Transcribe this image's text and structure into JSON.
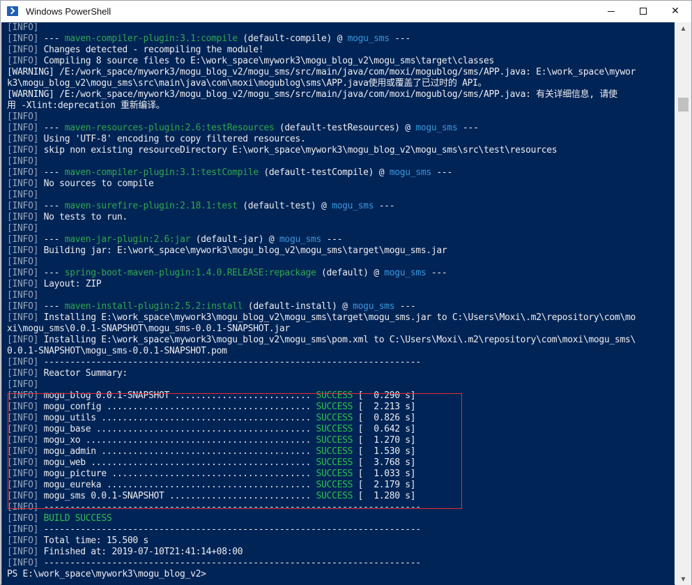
{
  "window": {
    "title": "Windows PowerShell",
    "buttons": {
      "minimize": "—",
      "maximize": "☐",
      "close": "✕"
    }
  },
  "colors": {
    "terminal_bg": "#012456",
    "success": "#2fbf4f",
    "plugin": "#2fa84f",
    "project": "#3a96dd",
    "highlight_border": "#e03030"
  },
  "icons": {
    "app": "powershell-icon"
  },
  "terminal": {
    "lines": [
      [
        {
          "t": "[INFO]",
          "c": "info"
        }
      ],
      [
        {
          "t": "[INFO]",
          "c": "info"
        },
        {
          "t": " --- ",
          "c": "text"
        },
        {
          "t": "maven-compiler-plugin:3.1:compile",
          "c": "plugin"
        },
        {
          "t": " (default-compile) @ ",
          "c": "text"
        },
        {
          "t": "mogu_sms",
          "c": "project"
        },
        {
          "t": " ---",
          "c": "text"
        }
      ],
      [
        {
          "t": "[INFO]",
          "c": "info"
        },
        {
          "t": " Changes detected - recompiling the module!",
          "c": "text"
        }
      ],
      [
        {
          "t": "[INFO]",
          "c": "info"
        },
        {
          "t": " Compiling 8 source files to E:\\work_space\\mywork3\\mogu_blog_v2\\mogu_sms\\target\\classes",
          "c": "text"
        }
      ],
      [
        {
          "t": "[WARNING] /E:/work_space/mywork3/mogu_blog_v2/mogu_sms/src/main/java/com/moxi/mogublog/sms/APP.java: E:\\work_space\\mywor",
          "c": "warn"
        }
      ],
      [
        {
          "t": "k3\\mogu_blog_v2\\mogu_sms\\src\\main\\java\\com\\moxi\\mogublog\\sms\\APP.java使用或覆盖了已过时的 API。",
          "c": "warn"
        }
      ],
      [
        {
          "t": "[WARNING] /E:/work_space/mywork3/mogu_blog_v2/mogu_sms/src/main/java/com/moxi/mogublog/sms/APP.java: 有关详细信息, 请使",
          "c": "warn"
        }
      ],
      [
        {
          "t": "用 -Xlint:deprecation 重新编译。",
          "c": "warn"
        }
      ],
      [
        {
          "t": "[INFO]",
          "c": "info"
        }
      ],
      [
        {
          "t": "[INFO]",
          "c": "info"
        },
        {
          "t": " --- ",
          "c": "text"
        },
        {
          "t": "maven-resources-plugin:2.6:testResources",
          "c": "plugin"
        },
        {
          "t": " (default-testResources) @ ",
          "c": "text"
        },
        {
          "t": "mogu_sms",
          "c": "project"
        },
        {
          "t": " ---",
          "c": "text"
        }
      ],
      [
        {
          "t": "[INFO]",
          "c": "info"
        },
        {
          "t": " Using 'UTF-8' encoding to copy filtered resources.",
          "c": "text"
        }
      ],
      [
        {
          "t": "[INFO]",
          "c": "info"
        },
        {
          "t": " skip non existing resourceDirectory E:\\work_space\\mywork3\\mogu_blog_v2\\mogu_sms\\src\\test\\resources",
          "c": "text"
        }
      ],
      [
        {
          "t": "[INFO]",
          "c": "info"
        }
      ],
      [
        {
          "t": "[INFO]",
          "c": "info"
        },
        {
          "t": " --- ",
          "c": "text"
        },
        {
          "t": "maven-compiler-plugin:3.1:testCompile",
          "c": "plugin"
        },
        {
          "t": " (default-testCompile) @ ",
          "c": "text"
        },
        {
          "t": "mogu_sms",
          "c": "project"
        },
        {
          "t": " ---",
          "c": "text"
        }
      ],
      [
        {
          "t": "[INFO]",
          "c": "info"
        },
        {
          "t": " No sources to compile",
          "c": "text"
        }
      ],
      [
        {
          "t": "[INFO]",
          "c": "info"
        }
      ],
      [
        {
          "t": "[INFO]",
          "c": "info"
        },
        {
          "t": " --- ",
          "c": "text"
        },
        {
          "t": "maven-surefire-plugin:2.18.1:test",
          "c": "plugin"
        },
        {
          "t": " (default-test) @ ",
          "c": "text"
        },
        {
          "t": "mogu_sms",
          "c": "project"
        },
        {
          "t": " ---",
          "c": "text"
        }
      ],
      [
        {
          "t": "[INFO]",
          "c": "info"
        },
        {
          "t": " No tests to run.",
          "c": "text"
        }
      ],
      [
        {
          "t": "[INFO]",
          "c": "info"
        }
      ],
      [
        {
          "t": "[INFO]",
          "c": "info"
        },
        {
          "t": " --- ",
          "c": "text"
        },
        {
          "t": "maven-jar-plugin:2.6:jar",
          "c": "plugin"
        },
        {
          "t": " (default-jar) @ ",
          "c": "text"
        },
        {
          "t": "mogu_sms",
          "c": "project"
        },
        {
          "t": " ---",
          "c": "text"
        }
      ],
      [
        {
          "t": "[INFO]",
          "c": "info"
        },
        {
          "t": " Building jar: E:\\work_space\\mywork3\\mogu_blog_v2\\mogu_sms\\target\\mogu_sms.jar",
          "c": "text"
        }
      ],
      [
        {
          "t": "[INFO]",
          "c": "info"
        }
      ],
      [
        {
          "t": "[INFO]",
          "c": "info"
        },
        {
          "t": " --- ",
          "c": "text"
        },
        {
          "t": "spring-boot-maven-plugin:1.4.0.RELEASE:repackage",
          "c": "plugin"
        },
        {
          "t": " (default) @ ",
          "c": "text"
        },
        {
          "t": "mogu_sms",
          "c": "project"
        },
        {
          "t": " ---",
          "c": "text"
        }
      ],
      [
        {
          "t": "[INFO]",
          "c": "info"
        },
        {
          "t": " Layout: ZIP",
          "c": "text"
        }
      ],
      [
        {
          "t": "[INFO]",
          "c": "info"
        }
      ],
      [
        {
          "t": "[INFO]",
          "c": "info"
        },
        {
          "t": " --- ",
          "c": "text"
        },
        {
          "t": "maven-install-plugin:2.5.2:install",
          "c": "plugin"
        },
        {
          "t": " (default-install) @ ",
          "c": "text"
        },
        {
          "t": "mogu_sms",
          "c": "project"
        },
        {
          "t": " ---",
          "c": "text"
        }
      ],
      [
        {
          "t": "[INFO]",
          "c": "info"
        },
        {
          "t": " Installing E:\\work_space\\mywork3\\mogu_blog_v2\\mogu_sms\\target\\mogu_sms.jar to C:\\Users\\Moxi\\.m2\\repository\\com\\mo",
          "c": "text"
        }
      ],
      [
        {
          "t": "xi\\mogu_sms\\0.0.1-SNAPSHOT\\mogu_sms-0.0.1-SNAPSHOT.jar",
          "c": "text"
        }
      ],
      [
        {
          "t": "[INFO]",
          "c": "info"
        },
        {
          "t": " Installing E:\\work_space\\mywork3\\mogu_blog_v2\\mogu_sms\\pom.xml to C:\\Users\\Moxi\\.m2\\repository\\com\\moxi\\mogu_sms\\",
          "c": "text"
        }
      ],
      [
        {
          "t": "0.0.1-SNAPSHOT\\mogu_sms-0.0.1-SNAPSHOT.pom",
          "c": "text"
        }
      ],
      [
        {
          "t": "[INFO]",
          "c": "info"
        },
        {
          "t": " ------------------------------------------------------------------------",
          "c": "text"
        }
      ],
      [
        {
          "t": "[INFO]",
          "c": "info"
        },
        {
          "t": " Reactor Summary:",
          "c": "text"
        }
      ],
      [
        {
          "t": "[INFO]",
          "c": "info"
        }
      ],
      [
        {
          "t": "[INFO]",
          "c": "info"
        },
        {
          "t": " mogu_blog 0.0.1-SNAPSHOT .......................... ",
          "c": "text"
        },
        {
          "t": "SUCCESS",
          "c": "success"
        },
        {
          "t": " [  0.290 s]",
          "c": "text"
        }
      ],
      [
        {
          "t": "[INFO]",
          "c": "info"
        },
        {
          "t": " mogu_config ....................................... ",
          "c": "text"
        },
        {
          "t": "SUCCESS",
          "c": "success"
        },
        {
          "t": " [  2.213 s]",
          "c": "text"
        }
      ],
      [
        {
          "t": "[INFO]",
          "c": "info"
        },
        {
          "t": " mogu_utils ........................................ ",
          "c": "text"
        },
        {
          "t": "SUCCESS",
          "c": "success"
        },
        {
          "t": " [  0.826 s]",
          "c": "text"
        }
      ],
      [
        {
          "t": "[INFO]",
          "c": "info"
        },
        {
          "t": " mogu_base ......................................... ",
          "c": "text"
        },
        {
          "t": "SUCCESS",
          "c": "success"
        },
        {
          "t": " [  0.642 s]",
          "c": "text"
        }
      ],
      [
        {
          "t": "[INFO]",
          "c": "info"
        },
        {
          "t": " mogu_xo ........................................... ",
          "c": "text"
        },
        {
          "t": "SUCCESS",
          "c": "success"
        },
        {
          "t": " [  1.270 s]",
          "c": "text"
        }
      ],
      [
        {
          "t": "[INFO]",
          "c": "info"
        },
        {
          "t": " mogu_admin ........................................ ",
          "c": "text"
        },
        {
          "t": "SUCCESS",
          "c": "success"
        },
        {
          "t": " [  1.530 s]",
          "c": "text"
        }
      ],
      [
        {
          "t": "[INFO]",
          "c": "info"
        },
        {
          "t": " mogu_web .......................................... ",
          "c": "text"
        },
        {
          "t": "SUCCESS",
          "c": "success"
        },
        {
          "t": " [  3.768 s]",
          "c": "text"
        }
      ],
      [
        {
          "t": "[INFO]",
          "c": "info"
        },
        {
          "t": " mogu_picture ...................................... ",
          "c": "text"
        },
        {
          "t": "SUCCESS",
          "c": "success"
        },
        {
          "t": " [  1.033 s]",
          "c": "text"
        }
      ],
      [
        {
          "t": "[INFO]",
          "c": "info"
        },
        {
          "t": " mogu_eureka ....................................... ",
          "c": "text"
        },
        {
          "t": "SUCCESS",
          "c": "success"
        },
        {
          "t": " [  2.179 s]",
          "c": "text"
        }
      ],
      [
        {
          "t": "[INFO]",
          "c": "info"
        },
        {
          "t": " mogu_sms 0.0.1-SNAPSHOT ........................... ",
          "c": "text"
        },
        {
          "t": "SUCCESS",
          "c": "success"
        },
        {
          "t": " [  1.280 s]",
          "c": "text"
        }
      ],
      [
        {
          "t": "[INFO]",
          "c": "info"
        },
        {
          "t": " ------------------------------------------------------------------------",
          "c": "text"
        }
      ],
      [
        {
          "t": "[INFO]",
          "c": "info"
        },
        {
          "t": " ",
          "c": "text"
        },
        {
          "t": "BUILD SUCCESS",
          "c": "success"
        }
      ],
      [
        {
          "t": "[INFO]",
          "c": "info"
        },
        {
          "t": " ------------------------------------------------------------------------",
          "c": "text"
        }
      ],
      [
        {
          "t": "[INFO]",
          "c": "info"
        },
        {
          "t": " Total time: 15.500 s",
          "c": "text"
        }
      ],
      [
        {
          "t": "[INFO]",
          "c": "info"
        },
        {
          "t": " Finished at: 2019-07-10T21:41:14+08:00",
          "c": "text"
        }
      ],
      [
        {
          "t": "[INFO]",
          "c": "info"
        },
        {
          "t": " ------------------------------------------------------------------------",
          "c": "text"
        }
      ],
      [
        {
          "t": "PS E:\\work_space\\mywork3\\mogu_blog_v2>",
          "c": "text"
        }
      ]
    ]
  }
}
